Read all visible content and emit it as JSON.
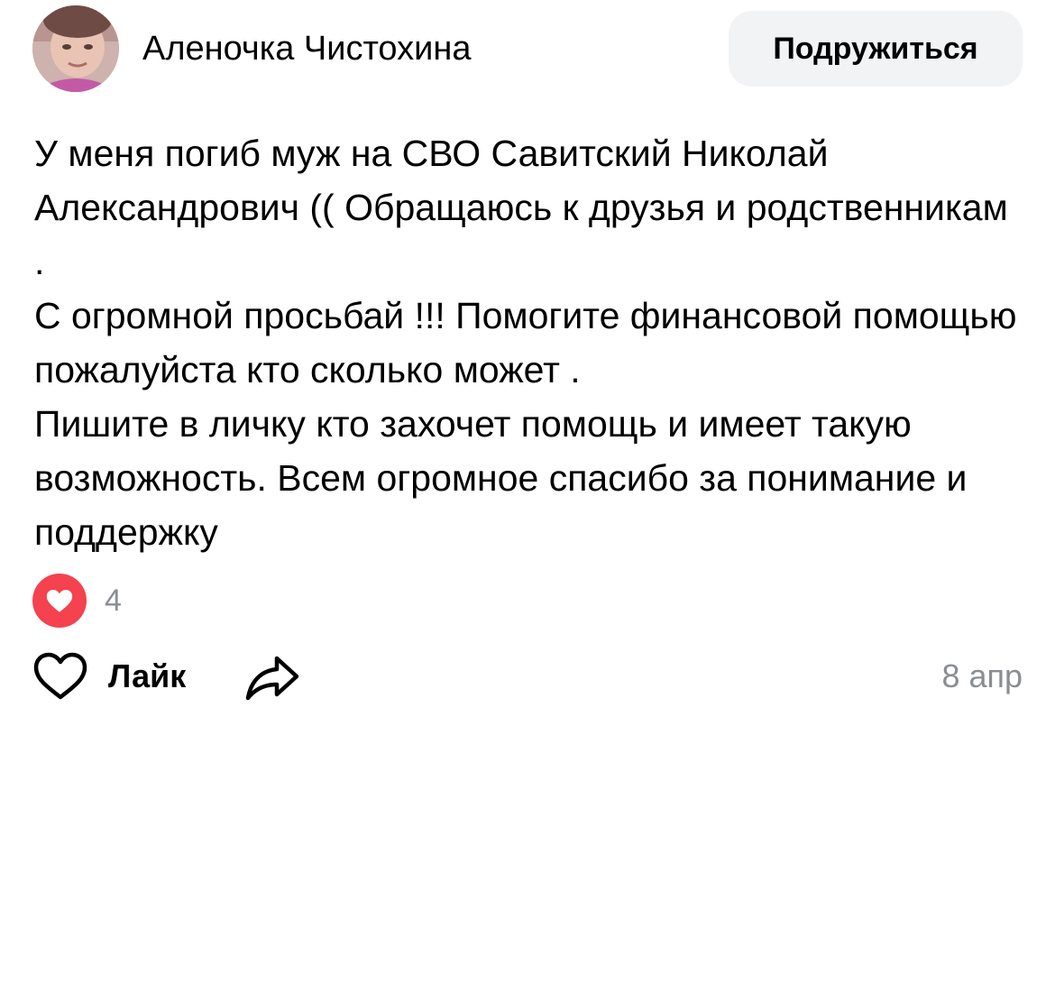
{
  "author": {
    "name": "Аленочка Чистохина",
    "avatar_icon": "user-photo"
  },
  "header": {
    "add_friend_label": "Подружиться"
  },
  "post": {
    "text": "У меня погиб муж на СВО Савитский Николай Александрович (( Обращаюсь к друзья и родственникам .\nС огромной просьбай !!! Помогите финансовой помощью  пожалуйста кто сколько может .\nПишите в личку кто захочет помощь и имеет такую возможность. Всем огромное спасибо за понимание и поддержку",
    "date": "8 апр"
  },
  "reactions": {
    "icon": "heart-icon",
    "count": "4",
    "color": "#f4424e"
  },
  "actions": {
    "like_label": "Лайк",
    "like_icon": "heart-outline-icon",
    "share_icon": "share-arrow-icon"
  }
}
